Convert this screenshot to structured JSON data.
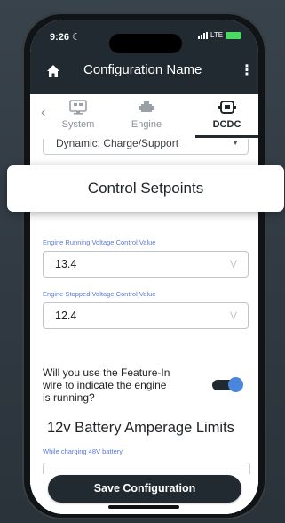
{
  "status": {
    "time": "9:26",
    "carrier": "LTE"
  },
  "nav": {
    "title": "Configuration Name"
  },
  "tabs": [
    {
      "label": "System",
      "state": "inactive"
    },
    {
      "label": "Engine",
      "state": "inactive"
    },
    {
      "label": "DCDC",
      "state": "active"
    }
  ],
  "mode_select": {
    "value": "Dynamic: Charge/Support"
  },
  "overlay": {
    "title": "Control Setpoints"
  },
  "engine_running": {
    "label": "Engine Running Voltage Control Value",
    "value": "13.4",
    "unit": "V"
  },
  "engine_stopped": {
    "label": "Engine Stopped Voltage Control Value",
    "value": "12.4",
    "unit": "V"
  },
  "feature_in": {
    "question": "Will you use the Feature-In wire to indicate the engine is running?",
    "enabled": true
  },
  "amperage": {
    "heading": "12v Battery Amperage Limits",
    "sub_label": "While charging 48V battery"
  },
  "footer": {
    "save_label": "Save Configuration"
  },
  "colors": {
    "header": "#212a31",
    "accent": "#4a86e0",
    "label_blue": "#5a7bd6",
    "toggle_track": "#212a31",
    "battery": "#4cd964"
  },
  "icons": [
    "home-icon",
    "more-vert-icon",
    "system-monitor-icon",
    "engine-icon",
    "dcdc-converter-icon",
    "chevron-left-icon",
    "chevron-down-icon",
    "moon-icon",
    "signal-icon",
    "battery-charging-icon"
  ]
}
